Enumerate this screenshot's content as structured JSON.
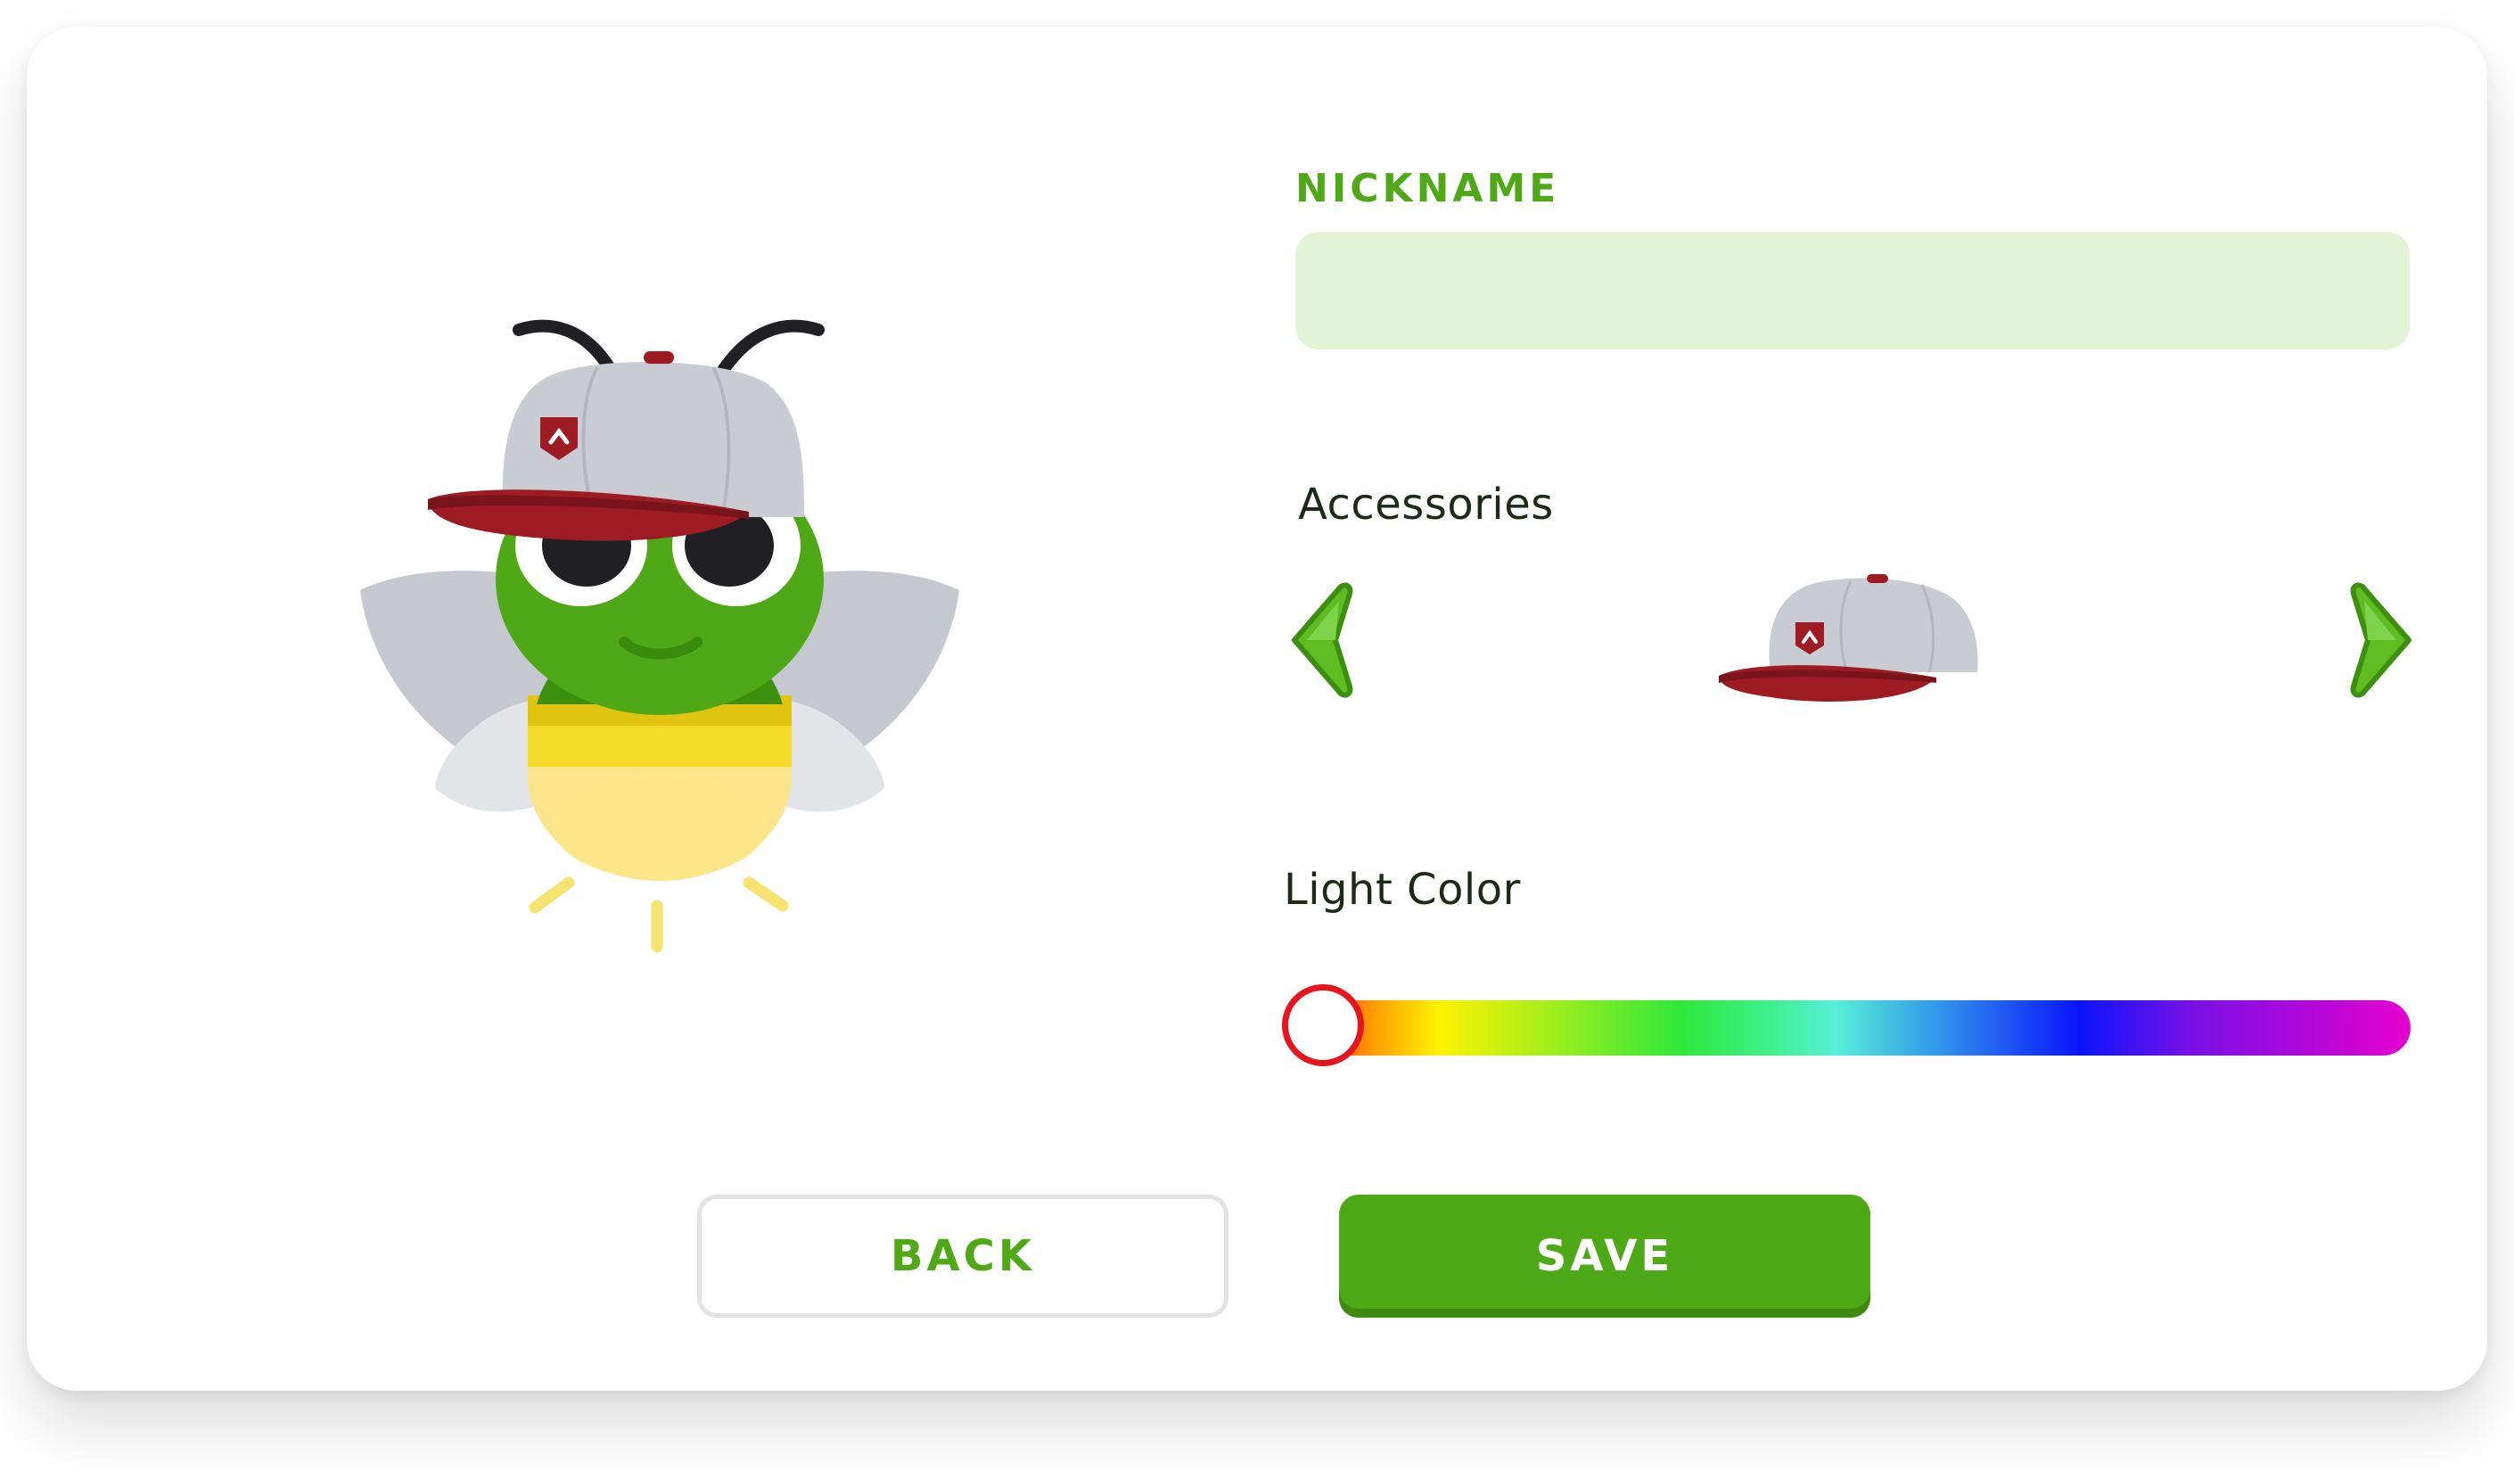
{
  "profile": {
    "nickname_label": "NICKNAME",
    "nickname_value": "",
    "nickname_placeholder": "",
    "accessories_label": "Accessories",
    "current_accessory": "cap",
    "light_color_label": "Light Color",
    "light_color_fraction": 0.0
  },
  "actions": {
    "back_label": "BACK",
    "save_label": "SAVE"
  },
  "colors": {
    "brand_green": "#4ea916",
    "input_background": "#e1f4d6",
    "cap_crown": "#c9ccd3",
    "cap_brim": "#9e1b24",
    "slider_thumb_border": "#e8141d"
  },
  "icons": {
    "prev": "chevron-left-icon",
    "next": "chevron-right-icon",
    "character": "firefly-icon",
    "accessory": "cap-icon"
  }
}
